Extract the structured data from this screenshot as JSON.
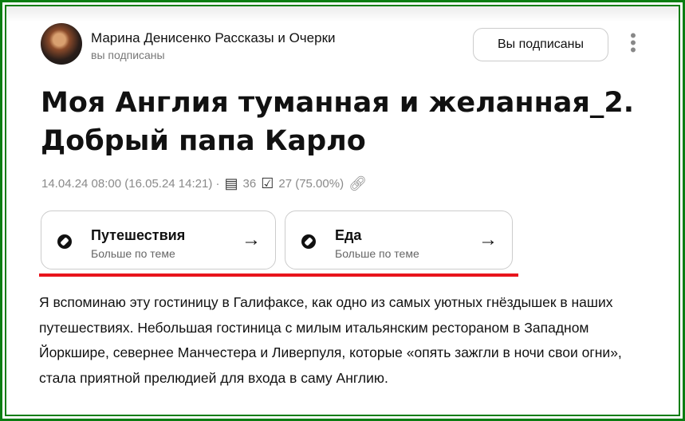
{
  "header": {
    "author": "Марина Денисенко Рассказы и Очерки",
    "status": "вы подписаны",
    "subscribe_button": "Вы подписаны",
    "more_icon": "⋮"
  },
  "article": {
    "title": "Моя Англия туманная и желанная_2. Добрый папа Карло",
    "meta": {
      "date": "14.04.24 08:00 (16.05.24 14:21) ·",
      "views": "36",
      "reads": "27 (75.00%)"
    },
    "topics": [
      {
        "title": "Путешествия",
        "subtitle": "Больше по теме"
      },
      {
        "title": "Еда",
        "subtitle": "Больше по теме"
      }
    ],
    "body": "Я вспоминаю эту гостиницу в Галифаксе, как одно из самых уютных гнёздышек в наших путешествиях. Небольшая гостиница с милым итальянским рестораном в Западном Йоркшире, севернее Манчестера и Ливерпуля, которые «опять зажгли в ночи свои огни», стала приятной прелюдией для входа в саму Англию."
  },
  "colors": {
    "border": "#0a7d12",
    "underline": "#e8141c"
  }
}
